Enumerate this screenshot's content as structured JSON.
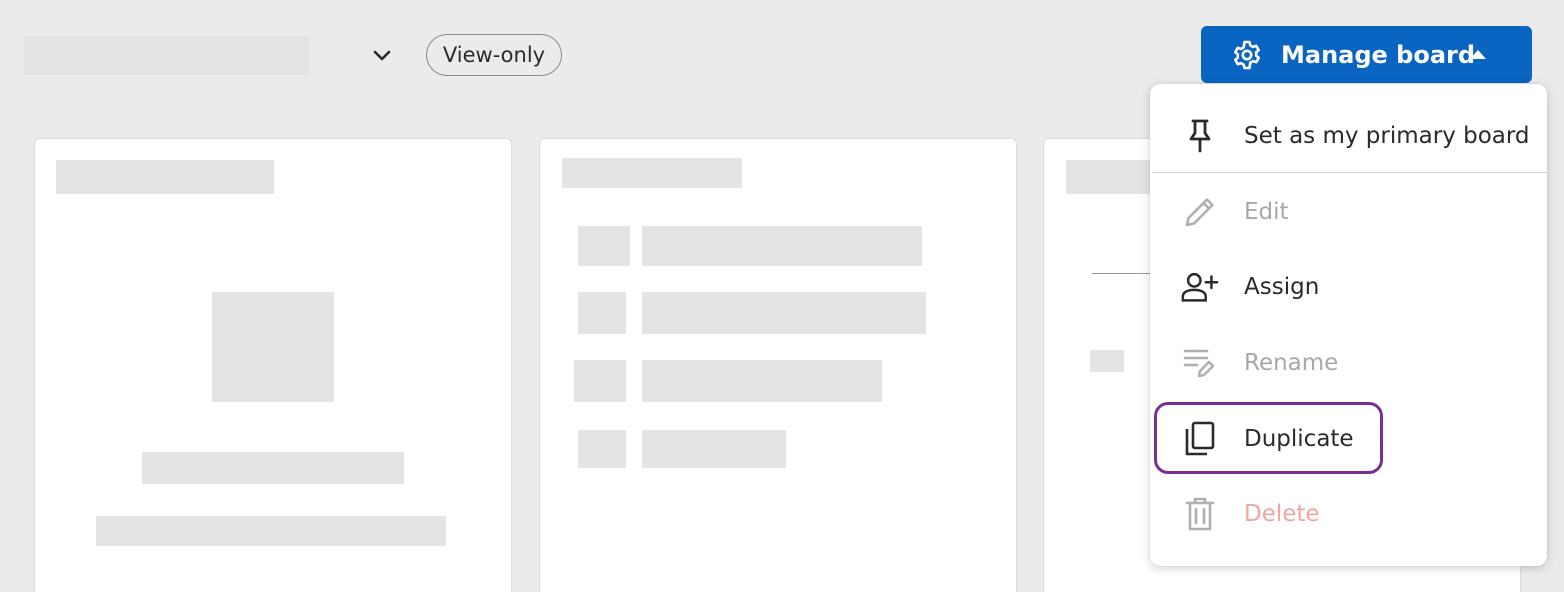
{
  "header": {
    "view_badge": "View-only",
    "manage_label": "Manage board",
    "icons": {
      "board_switch": "chevron-down-icon",
      "manage": "gear-icon",
      "manage_caret": "caret-up-icon"
    }
  },
  "menu": {
    "items": [
      {
        "label": "Set as my primary board",
        "icon": "pin-icon",
        "state": "enabled"
      },
      {
        "label": "Edit",
        "icon": "pencil-icon",
        "state": "disabled"
      },
      {
        "label": "Assign",
        "icon": "add-person-icon",
        "state": "enabled"
      },
      {
        "label": "Rename",
        "icon": "rename-icon",
        "state": "disabled"
      },
      {
        "label": "Duplicate",
        "icon": "copy-icon",
        "state": "enabled",
        "focused": true
      },
      {
        "label": "Delete",
        "icon": "trash-icon",
        "state": "disabled"
      }
    ]
  },
  "colors": {
    "primary": "#0a64c1",
    "focus_ring": "#7b2d96",
    "disabled_text": "#a8a8a8",
    "danger_disabled": "#f2a4a4",
    "background": "#ebebeb"
  }
}
